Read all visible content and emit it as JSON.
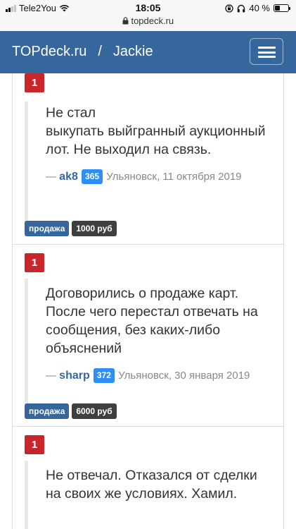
{
  "status_bar": {
    "carrier": "Tele2You",
    "time": "18:05",
    "url": "topdeck.ru",
    "battery": "40 %",
    "battery_level": 0.4
  },
  "navbar": {
    "site": "TOPdeck.ru",
    "separator": "/",
    "user": "Jackie"
  },
  "reviews": [
    {
      "rating": "1",
      "text": "Не стал\nвыкупать выйгранный аукционный лот. Не выходил на связь.",
      "dash": "—",
      "author": "ak8",
      "karma": "365",
      "location_date": "Ульяновск, 11 октября 2019",
      "tag_type": "продажа",
      "tag_price": "1000 руб"
    },
    {
      "rating": "1",
      "text": "Договорились о продаже карт. После чего перестал отвечать на сообщения, без каких-либо объяснений",
      "dash": "—",
      "author": "sharp",
      "karma": "372",
      "location_date": "Ульяновск, 30 января 2019",
      "tag_type": "продажа",
      "tag_price": "6000 руб"
    },
    {
      "rating": "1",
      "text": "Не отвечал. Отказался от сделки на своих же условиях. Хамил."
    }
  ]
}
